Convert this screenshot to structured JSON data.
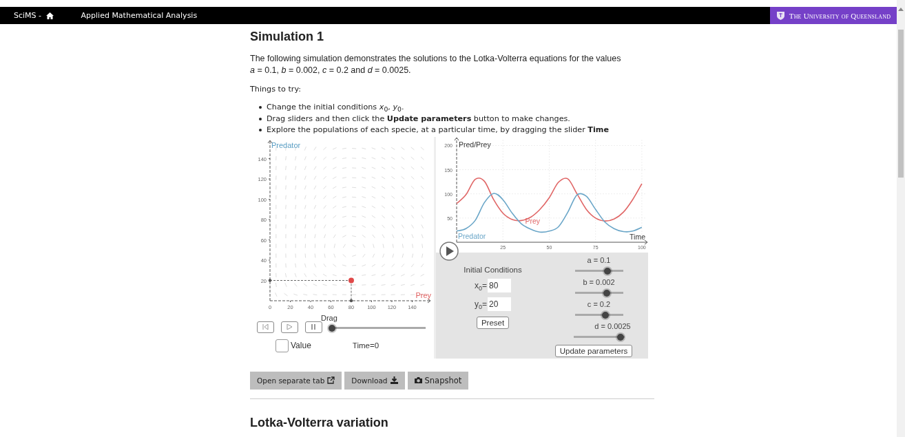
{
  "top_bar": {
    "site": "SciMS - ",
    "title": "Applied Mathematical Analysis",
    "university": "The University of Queensland"
  },
  "section": {
    "title": "Simulation 1",
    "intro": "The following simulation demonstrates the solutions to the Lotka-Volterra equations for the values *a* = 0.1, *b* = 0.002, *c* = 0.2 and *d* = 0.0025.",
    "things_label": "Things to try:",
    "bullets": [
      "Change the initial conditions *x*$_{0}$, *y*$_{0}$.",
      "Drag sliders and then click the **Update parameters** button to make changes.",
      "Explore the populations of each specie, at a particular time, by dragging the slider **Time**"
    ]
  },
  "applet": {
    "phase_plot": {
      "chart_data": {
        "type": "scatter",
        "xlabel": "Prey",
        "ylabel": "Predator",
        "x": [
          80
        ],
        "series": [
          {
            "color": "#e04848",
            "values": [
              20
            ]
          }
        ],
        "xlim": [
          0,
          158
        ],
        "ylim": [
          0,
          158
        ],
        "xticks": [
          0,
          20,
          40,
          60,
          80,
          100,
          120,
          140
        ],
        "yticks": [
          20,
          40,
          60,
          80,
          100,
          120,
          140
        ]
      }
    },
    "time_controls": {
      "drag_label": "Drag",
      "time_slider": {
        "level": 0
      },
      "value_checkbox": {
        "label": "Value",
        "checked": false
      },
      "time_readout": "Time=0"
    },
    "time_plot": {
      "chart_data": {
        "type": "line",
        "xlabel": "Time",
        "ylabel": "Pred/Prey",
        "x": [
          0,
          5,
          10,
          15,
          20,
          25,
          30,
          35,
          40,
          45,
          50,
          55,
          60,
          65,
          70,
          75,
          80,
          85,
          90,
          95,
          100
        ],
        "series": [
          {
            "name": "Prey",
            "color": "#e06666",
            "values": [
              80,
              98,
              130,
              126,
              88,
              60,
              47,
              45,
              52,
              68,
              92,
              124,
              131,
              100,
              68,
              50,
              44,
              48,
              62,
              88,
              121
            ]
          },
          {
            "name": "Predator",
            "color": "#6aa6c8",
            "values": [
              23,
              28,
              45,
              82,
              101,
              88,
              60,
              38,
              27,
              21,
              23,
              32,
              62,
              98,
              95,
              68,
              42,
              28,
              22,
              23,
              31
            ]
          }
        ],
        "xlim": [
          0,
          103
        ],
        "ylim": [
          0,
          212
        ],
        "xticks": [
          25,
          50,
          75,
          100
        ],
        "yticks": [
          50,
          100,
          150,
          200
        ],
        "grid": true
      }
    },
    "initial_conditions": {
      "title": "Initial Conditions",
      "fields": [
        {
          "label": "x$_{0}$=",
          "value": "80"
        },
        {
          "label": "y$_{0}$=",
          "value": "20"
        }
      ],
      "preset_button": "Preset"
    },
    "parameters": [
      {
        "label": "a = 0.1",
        "level": 0.68
      },
      {
        "label": "b = 0.002",
        "level": 0.67
      },
      {
        "label": "c = 0.2",
        "level": 0.64
      },
      {
        "label": "d = 0.0025",
        "level": 0.93
      }
    ],
    "update_button": "Update parameters"
  },
  "actions": [
    {
      "label": "Open separate tab",
      "kind": "external"
    },
    {
      "label": "Download",
      "kind": "download"
    },
    {
      "label": "Snapshot",
      "kind": "snapshot"
    }
  ],
  "next_section": {
    "title": "Lotka-Volterra variation"
  }
}
